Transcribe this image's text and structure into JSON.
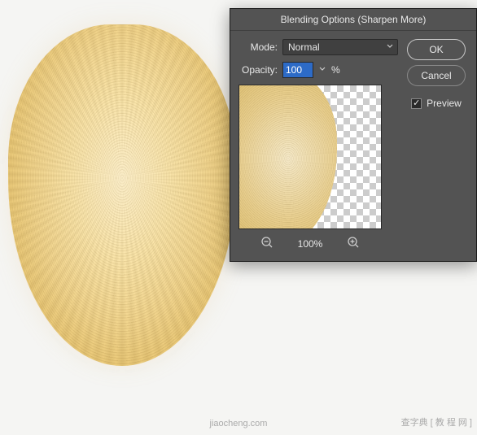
{
  "dialog": {
    "title": "Blending Options (Sharpen More)",
    "mode_label": "Mode:",
    "mode_value": "Normal",
    "opacity_label": "Opacity:",
    "opacity_value": "100",
    "opacity_unit": "%",
    "ok_label": "OK",
    "cancel_label": "Cancel",
    "preview_label": "Preview",
    "preview_checked": true,
    "zoom_level": "100%"
  },
  "watermark": {
    "left": "jiaocheng.com",
    "right": "查字典 [ 教 程 网 ]"
  }
}
